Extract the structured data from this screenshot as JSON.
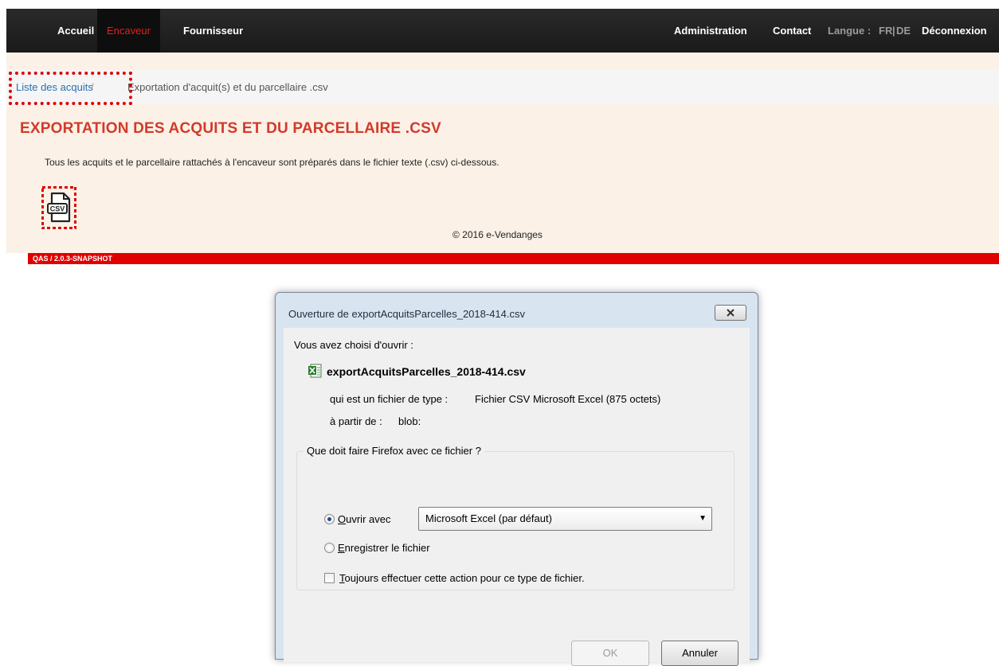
{
  "nav": {
    "accueil": "Accueil",
    "encaveur": "Encaveur",
    "fournisseur": "Fournisseur",
    "administration": "Administration",
    "contact": "Contact",
    "langue_label": "Langue :",
    "lang_fr": "FR",
    "lang_sep": "|",
    "lang_de": "DE",
    "deconnexion": "Déconnexion"
  },
  "breadcrumb": {
    "link": "Liste des acquits",
    "separator": "/",
    "current": "Exportation d'acquit(s) et du parcellaire .csv"
  },
  "page": {
    "title": "EXPORTATION DES ACQUITS ET DU PARCELLAIRE .CSV",
    "description": "Tous les acquits et le parcellaire rattachés à l'encaveur sont préparés dans le fichier texte (.csv) ci-dessous.",
    "csv_icon_label": "CSV",
    "footer": "© 2016 e-Vendanges",
    "version": "QAS / 2.0.3-SNAPSHOT"
  },
  "dialog": {
    "title": "Ouverture de exportAcquitsParcelles_2018-414.csv",
    "chosen_label": "Vous avez choisi d'ouvrir :",
    "filename": "exportAcquitsParcelles_2018-414.csv",
    "type_label": "qui est un fichier de type :",
    "type_value": "Fichier CSV Microsoft Excel (875 octets)",
    "from_label": "à partir de :",
    "from_value": "blob:",
    "group_legend": "Que doit faire Firefox avec ce fichier ?",
    "open_with_key": "O",
    "open_with_rest": "uvrir avec",
    "open_with_app": "Microsoft Excel (par défaut)",
    "save_key": "E",
    "save_rest": "nregistrer le fichier",
    "always_key": "T",
    "always_rest": "oujours effectuer cette action pour ce type de fichier.",
    "ok": "OK",
    "cancel": "Annuler"
  },
  "colors": {
    "accent_red": "#e00000",
    "title_red": "#d23a2b",
    "link_blue": "#2a6fb0"
  }
}
